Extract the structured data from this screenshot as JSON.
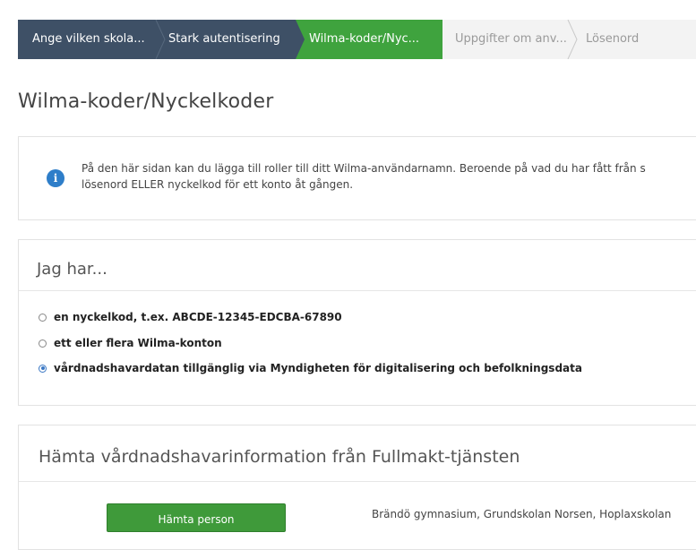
{
  "steps": [
    {
      "label": "Ange vilken skola...",
      "state": "done"
    },
    {
      "label": "Stark autentisering",
      "state": "done"
    },
    {
      "label": "Wilma-koder/Nyc...",
      "state": "active"
    },
    {
      "label": "Uppgifter om anv...",
      "state": "todo"
    },
    {
      "label": "Lösenord",
      "state": "todo"
    }
  ],
  "page_title": "Wilma-koder/Nyckelkoder",
  "info": {
    "icon": "info-icon",
    "line1": "På den här sidan kan du lägga till roller till ditt Wilma-användarnamn. Beroende på vad du har fått från s",
    "line2": "lösenord ELLER nyckelkod för ett konto åt gången."
  },
  "choice": {
    "title": "Jag har...",
    "options": [
      {
        "label": "en nyckelkod, t.ex. ABCDE-12345-EDCBA-67890",
        "checked": false
      },
      {
        "label": "ett eller flera Wilma-konton",
        "checked": false
      },
      {
        "label": "vårdnadshavardatan tillgänglig via Myndigheten för digitalisering och befolkningsdata",
        "checked": true
      }
    ]
  },
  "fetch": {
    "title": "Hämta vårdnadshavarinformation från Fullmakt-tjänsten",
    "button_label": "Hämta person",
    "schools": "Brändö gymnasium, Grundskolan Norsen, Hoplaxskolan"
  },
  "colors": {
    "step_done": "#3e5066",
    "step_active": "#3fa33e",
    "button": "#3f9a3a",
    "info_icon": "#2e7ec9"
  }
}
